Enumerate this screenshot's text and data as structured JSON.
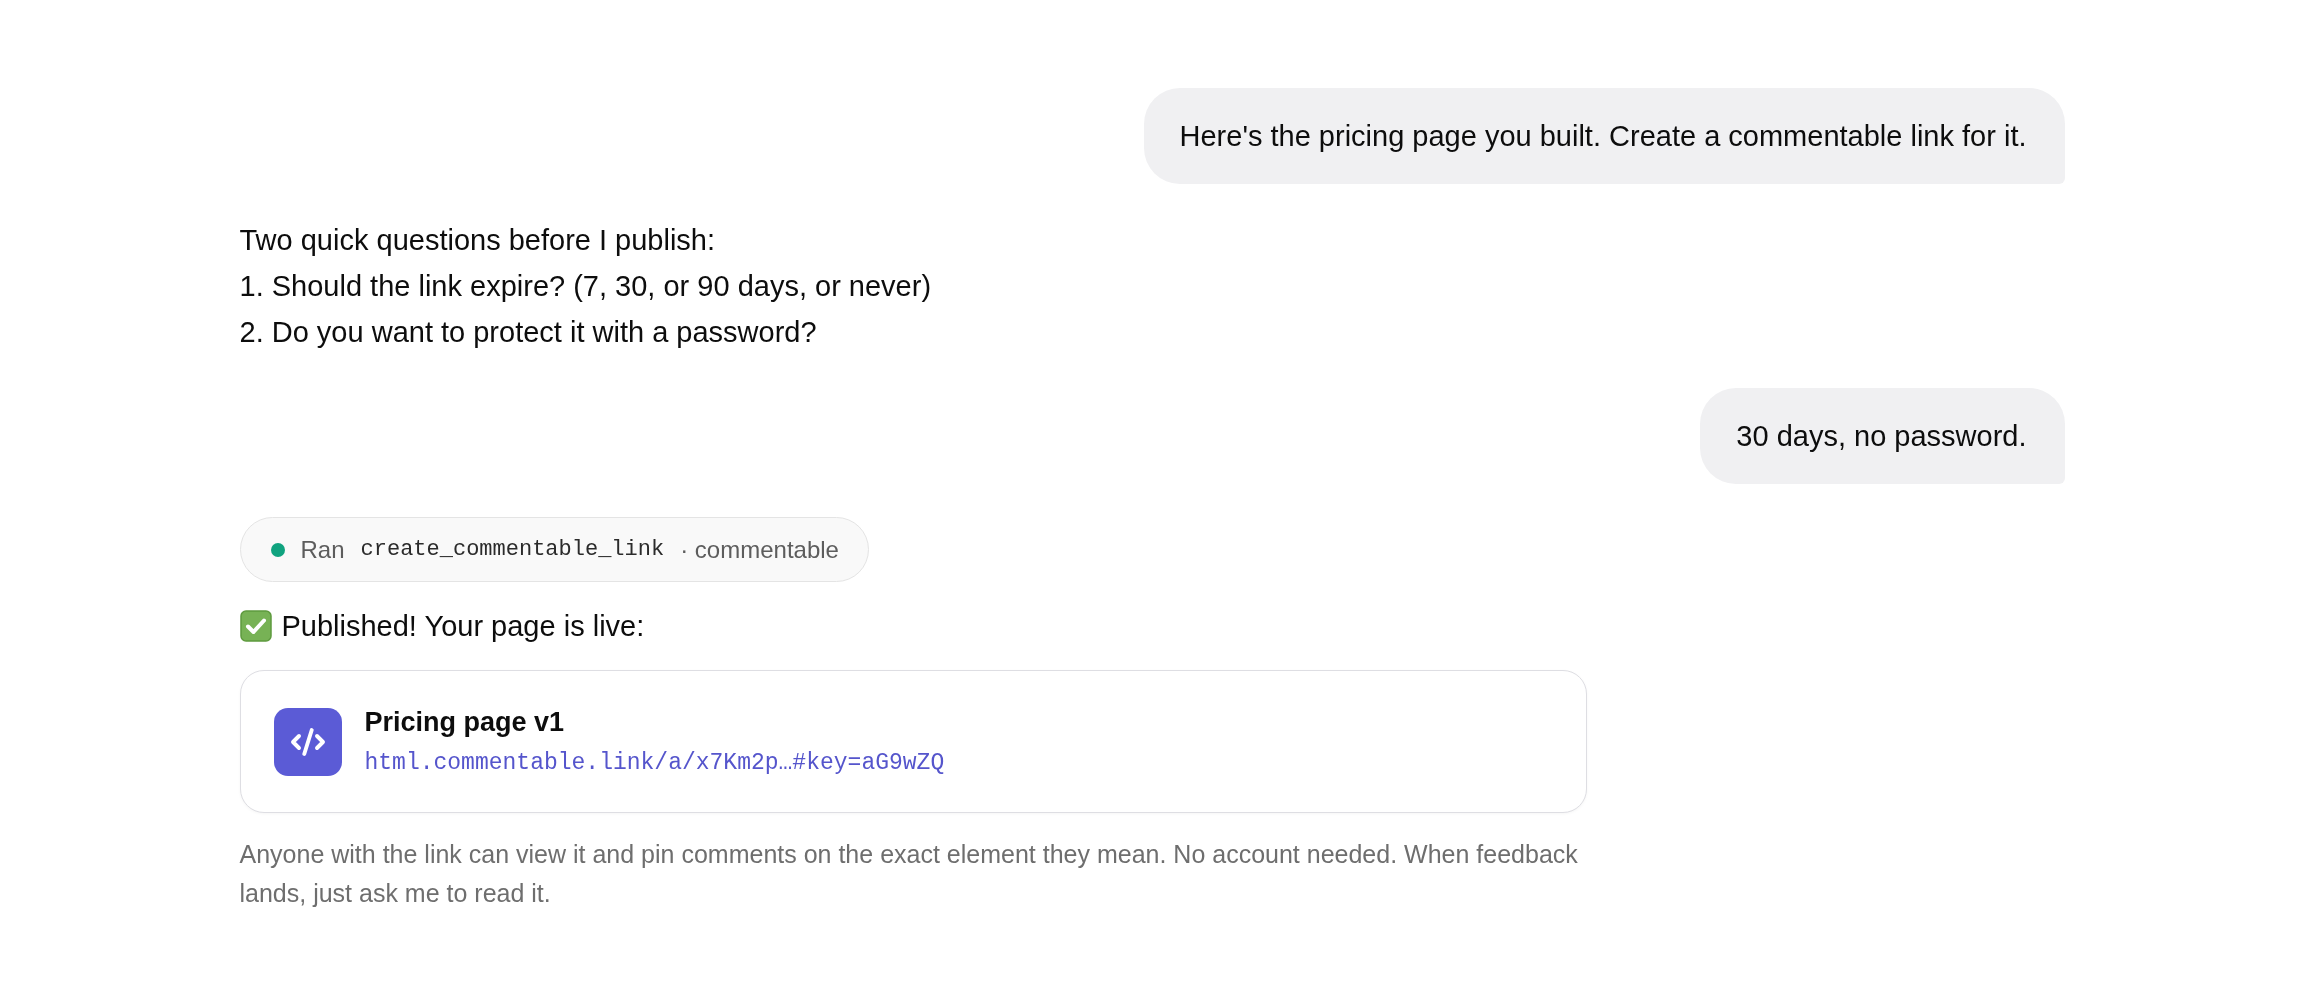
{
  "messages": [
    {
      "kind": "user",
      "text": "Here's the pricing page you built. Create a commentable link for it."
    },
    {
      "kind": "assistant",
      "blocks": [
        {
          "kind": "paragraph",
          "lines": [
            "Two quick questions before I publish:",
            "1. Should the link expire? (7, 30, or 90 days, or never)",
            "2. Do you want to protect it with a password?"
          ]
        }
      ]
    },
    {
      "kind": "user",
      "text": "30 days, no password."
    },
    {
      "kind": "assistant",
      "blocks": [
        {
          "kind": "tool_call",
          "completed": true,
          "verb": "Ran",
          "tool": "create_commentable_link",
          "source": "· commentable"
        },
        {
          "kind": "status_line",
          "text": "Published! Your page is live:"
        },
        {
          "kind": "link_card",
          "title": "Pricing page v1",
          "url": "html.commentable.link/a/x7Km2p…#key=aG9wZQ"
        },
        {
          "kind": "note",
          "text": "Anyone with the link can view it and pin comments on the exact element they mean. No account needed. When feedback lands, just ask me to read it."
        }
      ]
    }
  ]
}
